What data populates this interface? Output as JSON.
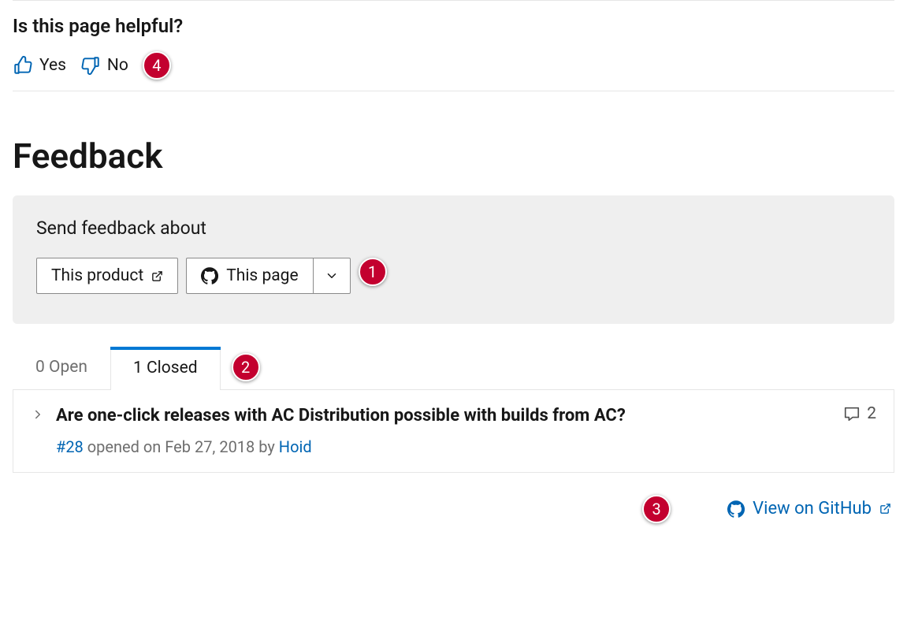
{
  "helpful": {
    "title": "Is this page helpful?",
    "yes_label": "Yes",
    "no_label": "No"
  },
  "feedback": {
    "heading": "Feedback",
    "send_label": "Send feedback about",
    "product_button_label": "This product",
    "page_button_label": "This page"
  },
  "tabs": {
    "open_label": "0 Open",
    "closed_label": "1 Closed"
  },
  "issue": {
    "title": "Are one-click releases with AC Distribution possible with builds from AC?",
    "number": "#28",
    "opened_text": " opened on Feb 27, 2018 by ",
    "author": "Hoid",
    "comment_count": "2"
  },
  "footer": {
    "view_github_label": "View on GitHub"
  },
  "annotations": {
    "a1": "1",
    "a2": "2",
    "a3": "3",
    "a4": "4"
  }
}
